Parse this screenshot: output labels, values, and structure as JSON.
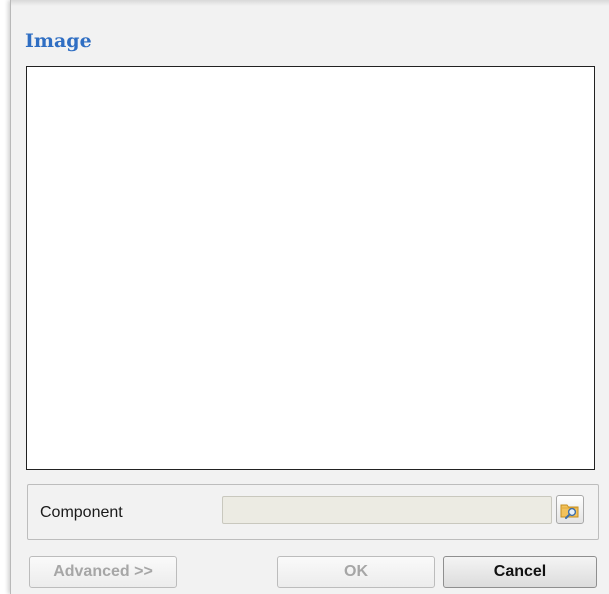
{
  "dialog": {
    "title": "Image"
  },
  "component": {
    "label": "Component",
    "value": ""
  },
  "buttons": {
    "advanced_label": "Advanced >>",
    "ok_label": "OK",
    "cancel_label": "Cancel"
  },
  "icons": {
    "browse": "folder-search-icon"
  },
  "colors": {
    "title": "#2f6ec3",
    "disabled_text": "#a6a6a6"
  }
}
